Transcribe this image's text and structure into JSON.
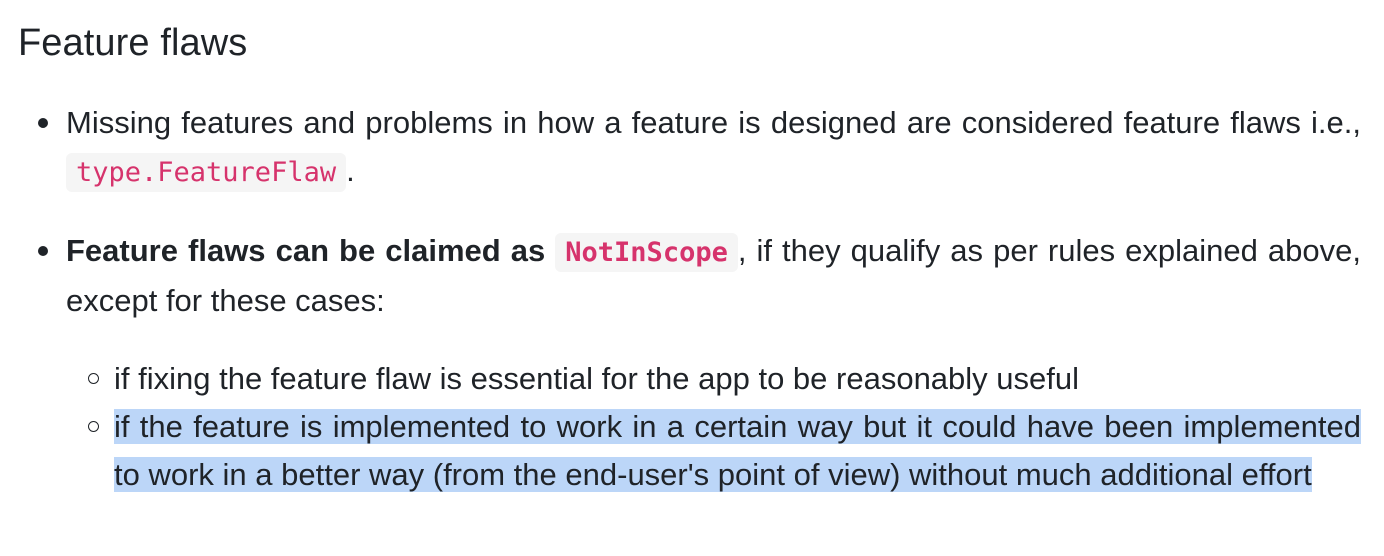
{
  "section": {
    "title": "Feature flaws"
  },
  "bullets": [
    {
      "text_before": "Missing features and problems in how a feature is designed are considered feature flaws i.e.,",
      "code": "type.FeatureFlaw",
      "text_after": "."
    },
    {
      "bold_text": "Feature flaws can be claimed as",
      "code": "NotInScope",
      "text_after": ", if they qualify as per rules explained above, except for these cases:",
      "sub_bullets": [
        {
          "text": "if fixing the feature flaw is essential for the app to be reasonably useful",
          "selected": false
        },
        {
          "text": "if the feature is implemented to work in a certain way but it could have been implemented to work in a better way (from the end-user's point of view) without much additional effort",
          "selected": true
        }
      ]
    }
  ],
  "colors": {
    "text": "#1f2328",
    "code_text": "#d6336c",
    "code_background": "#f5f5f5",
    "selection": "#bcd6f8"
  }
}
